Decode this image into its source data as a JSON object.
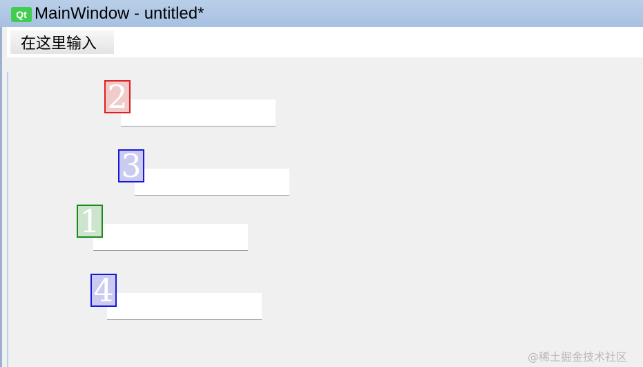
{
  "window": {
    "icon_label": "Qt",
    "title": "MainWindow - untitled*"
  },
  "menubar": {
    "item_label": "在这里输入"
  },
  "fields": [
    {
      "badge": "2",
      "value": ""
    },
    {
      "badge": "3",
      "value": ""
    },
    {
      "badge": "1",
      "value": ""
    },
    {
      "badge": "4",
      "value": ""
    }
  ],
  "colors": {
    "tab_order_red": "#e01e1e",
    "tab_order_blue": "#1818d8",
    "tab_order_green": "#1a8a1a"
  },
  "watermark": "@稀土掘金技术社区"
}
